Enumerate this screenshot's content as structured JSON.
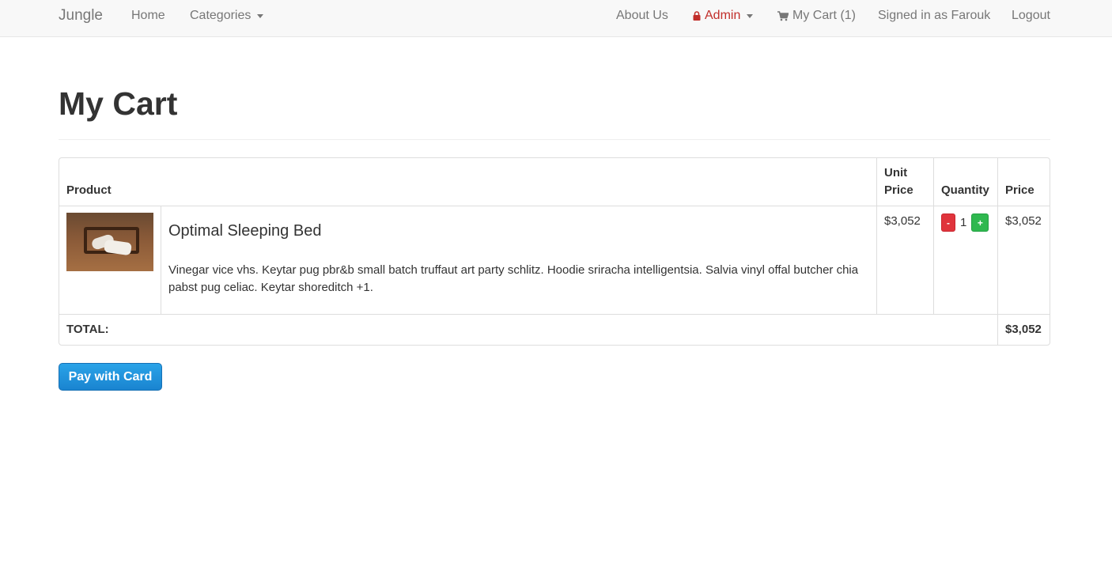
{
  "navbar": {
    "brand": "Jungle",
    "home": "Home",
    "categories": "Categories",
    "about": "About Us",
    "admin": "Admin",
    "cart": "My Cart (1)",
    "signed_in": "Signed in as Farouk",
    "logout": "Logout"
  },
  "page": {
    "title": "My Cart"
  },
  "table": {
    "headers": {
      "product": "Product",
      "unit_price": "Unit Price",
      "quantity": "Quantity",
      "price": "Price"
    },
    "items": [
      {
        "name": "Optimal Sleeping Bed",
        "description": "Vinegar vice vhs. Keytar pug pbr&b small batch truffaut art party schlitz. Hoodie sriracha intelligentsia. Salvia vinyl offal butcher chia pabst pug celiac. Keytar shoreditch +1.",
        "unit_price": "$3,052",
        "quantity": "1",
        "price": "$3,052",
        "minus_label": "-",
        "plus_label": "+"
      }
    ],
    "total_label": "TOTAL:",
    "total_value": "$3,052"
  },
  "pay_button": "Pay with Card",
  "colors": {
    "admin": "#c12e2a",
    "minus": "#e0343c",
    "plus": "#2fb84f",
    "pay": "#1a84d0"
  },
  "icons": {
    "admin": "lock-icon",
    "cart": "cart-icon",
    "categories_caret": "caret-down-icon",
    "admin_caret": "caret-down-icon"
  }
}
